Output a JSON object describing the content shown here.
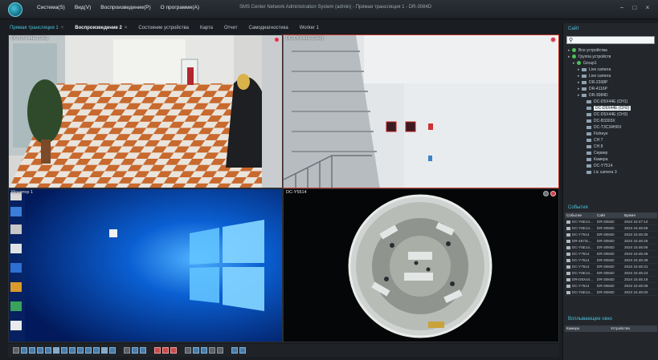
{
  "window": {
    "title": "SMS Center Network Administration System (admin) - Прямая трансляция 1 - DR-3084D",
    "controls": [
      "−",
      "□",
      "×"
    ]
  },
  "menu": [
    "Система(S)",
    "Вид(V)",
    "Воспроизведение(P)",
    "О программе(A)"
  ],
  "tabs": [
    {
      "label": "Прямая трансляция 1",
      "state": "active"
    },
    {
      "label": "Воспроизведение 2",
      "state": "bold"
    },
    {
      "label": "Состояние устройства",
      "state": ""
    },
    {
      "label": "Карта",
      "state": ""
    },
    {
      "label": "Отчет",
      "state": ""
    },
    {
      "label": "Самодиагностика",
      "state": ""
    },
    {
      "label": "Worker 1",
      "state": ""
    }
  ],
  "tiles": [
    {
      "title": "DC-D5X44E (CH1)",
      "scene": "hallway",
      "selected": false
    },
    {
      "title": "DC-D5X44E (CH2)",
      "scene": "stairs",
      "selected": true
    },
    {
      "title": "Монитор 1",
      "scene": "desktop",
      "selected": false
    },
    {
      "title": "DC-Y5514",
      "scene": "fisheye",
      "selected": false
    }
  ],
  "right_panel": {
    "site_title": "Сайт",
    "search_placeholder": "",
    "tree": [
      {
        "label": "Все устройства",
        "depth": 0,
        "icon": "green",
        "selected": false
      },
      {
        "label": "Группа устройств",
        "depth": 0,
        "icon": "green",
        "selected": false
      },
      {
        "label": "Group1",
        "depth": 1,
        "icon": "green",
        "selected": false
      },
      {
        "label": "Live camera",
        "depth": 2,
        "icon": "grey",
        "selected": false
      },
      {
        "label": "Live camera",
        "depth": 2,
        "icon": "grey",
        "selected": false
      },
      {
        "label": "DR-2308P",
        "depth": 2,
        "icon": "grey",
        "selected": false
      },
      {
        "label": "DR-4116P",
        "depth": 2,
        "icon": "grey",
        "selected": false
      },
      {
        "label": "DR-3084D",
        "depth": 2,
        "icon": "grey",
        "selected": false
      },
      {
        "label": "DC-D5X44E (CH1)",
        "depth": 3,
        "icon": "grey",
        "selected": false
      },
      {
        "label": "DC-D5X44E (CH2)",
        "depth": 3,
        "icon": "grey",
        "selected": true
      },
      {
        "label": "DC-D5X44E (CH3)",
        "depth": 3,
        "icon": "grey",
        "selected": false
      },
      {
        "label": "DC-B3303X",
        "depth": 3,
        "icon": "grey",
        "selected": false
      },
      {
        "label": "DC-T3C34HRX",
        "depth": 3,
        "icon": "grey",
        "selected": false
      },
      {
        "label": "Fisheye",
        "depth": 3,
        "icon": "grey",
        "selected": false
      },
      {
        "label": "CH 7",
        "depth": 3,
        "icon": "grey",
        "selected": false
      },
      {
        "label": "CH 8",
        "depth": 3,
        "icon": "grey",
        "selected": false
      },
      {
        "label": "Сервер",
        "depth": 3,
        "icon": "grey",
        "selected": false
      },
      {
        "label": "Камера",
        "depth": 3,
        "icon": "grey",
        "selected": false
      },
      {
        "label": "DC-Y7514",
        "depth": 3,
        "icon": "grey",
        "selected": false
      },
      {
        "label": "Lic camera 3",
        "depth": 3,
        "icon": "grey",
        "selected": false
      }
    ],
    "events_title": "События",
    "events_header": {
      "event": "Событие",
      "site": "Сайт",
      "time": "Время"
    },
    "events": [
      {
        "event": "DC-Y5E14...",
        "site": "DR-3084D",
        "time": "2024 15:47:10"
      },
      {
        "event": "DC-Y5E14...",
        "site": "DR-3084D",
        "time": "2024 15:46:58"
      },
      {
        "event": "DC-Y7514",
        "site": "DR-3084D",
        "time": "2024 15:46:35"
      },
      {
        "event": "DR-4572L...",
        "site": "DR-3084D",
        "time": "2024 15:46:25"
      },
      {
        "event": "DC-Y5E14...",
        "site": "DR-3084D",
        "time": "2024 15:46:06"
      },
      {
        "event": "DC-Y7514",
        "site": "DR-3084D",
        "time": "2024 15:45:48"
      },
      {
        "event": "DC-Y7514",
        "site": "DR-3084D",
        "time": "2024 15:45:39"
      },
      {
        "event": "DC-Y7514",
        "site": "DR-3084D",
        "time": "2024 15:45:31"
      },
      {
        "event": "DC-Y5E14...",
        "site": "DR-3084D",
        "time": "2024 15:45:24"
      },
      {
        "event": "DR-D5X44...",
        "site": "DR-3084D",
        "time": "2024 15:45:16"
      },
      {
        "event": "DC-Y7514",
        "site": "DR-3084D",
        "time": "2024 15:45:09"
      },
      {
        "event": "DC-Y5E14...",
        "site": "DR-3084D",
        "time": "2024 15:45:00"
      }
    ],
    "imports_title": "Всплывающее окно",
    "imports_header": {
      "camera": "Камера",
      "device": "Устройство"
    }
  }
}
